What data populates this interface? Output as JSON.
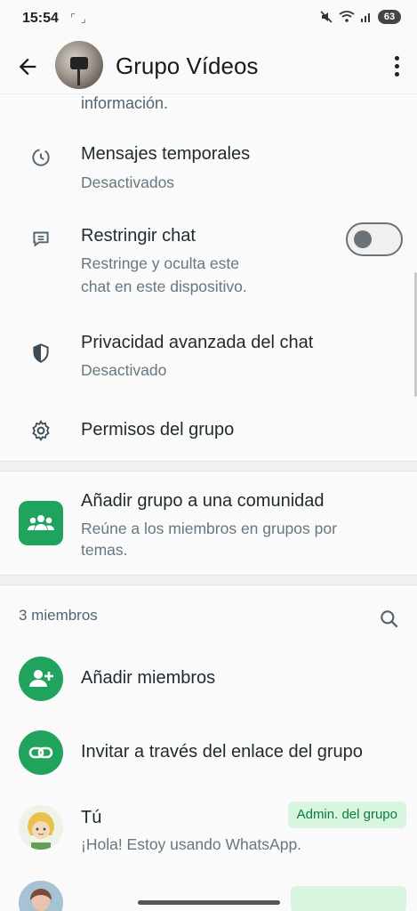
{
  "status_bar": {
    "time": "15:54",
    "extra": "⌜ ⌟",
    "icons": "🔕 ≋ ▮",
    "battery": "63"
  },
  "header": {
    "title": "Grupo Vídeos"
  },
  "partial_text": "información.",
  "settings": [
    {
      "title": "Mensajes temporales",
      "sub": "Desactivados",
      "icon": "timer-icon"
    },
    {
      "title": "Restringir chat",
      "sub_lines": [
        "Restringe y oculta este",
        "chat en este dispositivo."
      ],
      "icon": "lock-chat-icon",
      "toggle_on": false
    },
    {
      "title": "Privacidad avanzada del chat",
      "sub": "Desactivado",
      "icon": "shield-icon"
    },
    {
      "title": "Permisos del grupo",
      "icon": "gear-icon"
    }
  ],
  "community": {
    "title": "Añadir grupo a una comunidad",
    "sub_lines": [
      "Reúne a los miembros en grupos por",
      "temas."
    ]
  },
  "members": {
    "count_label": "3 miembros",
    "add_label": "Añadir miembros",
    "invite_label": "Invitar a través del enlace del grupo",
    "list": [
      {
        "name": "Tú",
        "status": "¡Hola! Estoy usando WhatsApp.",
        "badge": "Admin. del grupo"
      },
      {
        "name": "",
        "status": "",
        "badge": ""
      }
    ]
  },
  "colors": {
    "accent": "#1fa35d",
    "badge_bg": "#d8f5df",
    "badge_text": "#0a7c3c"
  }
}
